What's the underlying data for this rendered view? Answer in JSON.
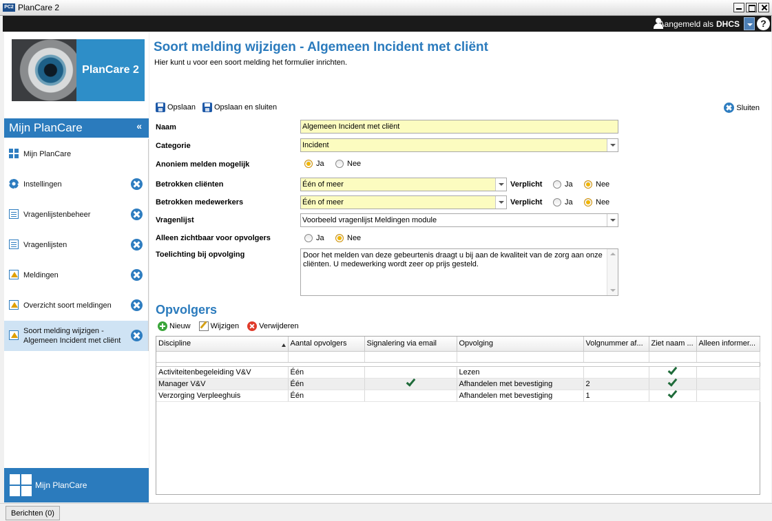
{
  "window": {
    "badge": "PC2",
    "title": "PlanCare 2"
  },
  "userbar": {
    "login_label": "Aangemeld als",
    "user": "DHCS",
    "help": "?"
  },
  "logo": {
    "brand": "PlanCare 2"
  },
  "nav": {
    "header": "Mijn PlanCare",
    "collapse": "«",
    "items": [
      {
        "label": "Mijn PlanCare",
        "icon": "grid-icon",
        "closable": false
      },
      {
        "label": "Instellingen",
        "icon": "gear-icon",
        "closable": true
      },
      {
        "label": "Vragenlijstenbeheer",
        "icon": "document-icon",
        "closable": true
      },
      {
        "label": "Vragenlijsten",
        "icon": "document-icon",
        "closable": true
      },
      {
        "label": "Meldingen",
        "icon": "warning-icon",
        "closable": true
      },
      {
        "label": "Overzicht soort meldingen",
        "icon": "warning-icon",
        "closable": true
      },
      {
        "label_line1": "Soort melding wijzigen -",
        "label_line2": "Algemeen Incident met cliënt",
        "icon": "warning-icon",
        "closable": true,
        "active": true
      }
    ],
    "footer": "Mijn PlanCare"
  },
  "page": {
    "title": "Soort melding wijzigen - Algemeen Incident met cliënt",
    "subtitle": "Hier kunt u voor een soort melding het formulier inrichten."
  },
  "toolbar": {
    "save": "Opslaan",
    "save_close": "Opslaan en sluiten",
    "close": "Sluiten"
  },
  "form": {
    "naam_label": "Naam",
    "naam_value": "Algemeen Incident met cliënt",
    "categorie_label": "Categorie",
    "categorie_value": "Incident",
    "anoniem_label": "Anoniem melden mogelijk",
    "anoniem_ja": "Ja",
    "anoniem_nee": "Nee",
    "anoniem_selected": "Ja",
    "clienten_label": "Betrokken cliënten",
    "clienten_value": "Één of meer",
    "clienten_verplicht": "Verplicht",
    "clienten_ja": "Ja",
    "clienten_nee": "Nee",
    "clienten_selected": "Nee",
    "medewerkers_label": "Betrokken medewerkers",
    "medewerkers_value": "Één of meer",
    "medewerkers_verplicht": "Verplicht",
    "medewerkers_ja": "Ja",
    "medewerkers_nee": "Nee",
    "medewerkers_selected": "Nee",
    "vragenlijst_label": "Vragenlijst",
    "vragenlijst_value": "Voorbeeld vragenlijst Meldingen module",
    "zichtbaar_label": "Alleen zichtbaar voor opvolgers",
    "zichtbaar_ja": "Ja",
    "zichtbaar_nee": "Nee",
    "zichtbaar_selected": "Nee",
    "toelichting_label": "Toelichting bij opvolging",
    "toelichting_value": "Door het melden van deze gebeurtenis draagt u bij aan de kwaliteit van de zorg aan onze cliënten. U medewerking wordt zeer op prijs gesteld."
  },
  "opvolgers": {
    "title": "Opvolgers",
    "new": "Nieuw",
    "edit": "Wijzigen",
    "delete": "Verwijderen",
    "columns": [
      "Discipline",
      "Aantal opvolgers",
      "Signalering via email",
      "Opvolging",
      "Volgnummer af...",
      "Ziet naam ...",
      "Alleen informer..."
    ],
    "rows": [
      {
        "discipline": "Activiteitenbegeleiding V&V",
        "aantal": "Één",
        "email": false,
        "opvolging": "Lezen",
        "volgnummer": "",
        "ziet_naam": true,
        "alleen": ""
      },
      {
        "discipline": "Manager V&V",
        "aantal": "Één",
        "email": true,
        "opvolging": "Afhandelen met bevestiging",
        "volgnummer": "2",
        "ziet_naam": true,
        "alleen": ""
      },
      {
        "discipline": "Verzorging Verpleeghuis",
        "aantal": "Één",
        "email": false,
        "opvolging": "Afhandelen met bevestiging",
        "volgnummer": "1",
        "ziet_naam": true,
        "alleen": ""
      }
    ]
  },
  "status": {
    "tab": "Berichten (0)"
  },
  "colors": {
    "accent": "#2b7bbd",
    "field_required": "#fcfcc0",
    "check": "#1f6b3a"
  }
}
